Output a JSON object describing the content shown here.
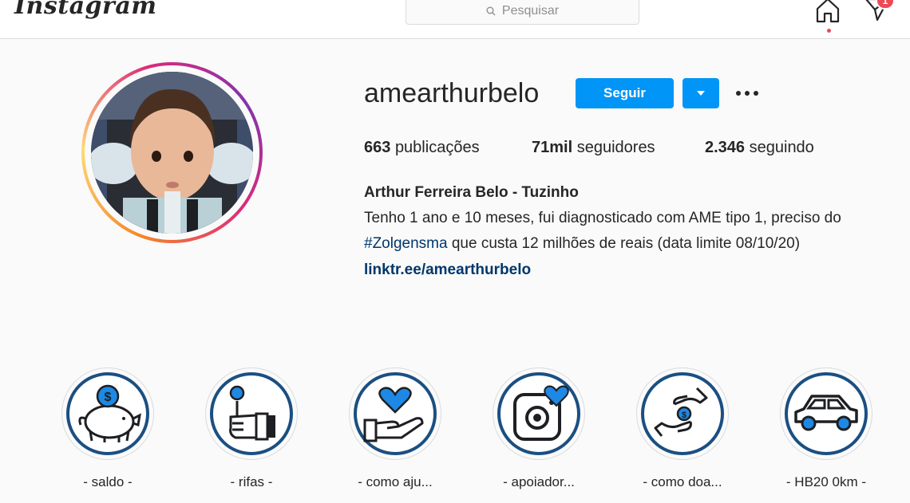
{
  "nav": {
    "logo": "Instagram",
    "search_placeholder": "Pesquisar",
    "notification_count": "1"
  },
  "profile": {
    "username": "amearthurbelo",
    "follow_label": "Seguir",
    "stats": {
      "posts_count": "663",
      "posts_label": "publicações",
      "followers_count": "71mil",
      "followers_label": "seguidores",
      "following_count": "2.346",
      "following_label": "seguindo"
    },
    "full_name": "Arthur Ferreira Belo - Tuzinho",
    "bio_line1": "Tenho 1 ano e 10 meses, fui diagnosticado com AME tipo 1, preciso do",
    "bio_hashtag": "#Zolgensma",
    "bio_line2_rest": " que custa 12 milhões de reais (data limite 08/10/20)",
    "link": "linktr.ee/amearthurbelo"
  },
  "highlights": [
    {
      "label": "- saldo -",
      "icon": "piggy-bank-icon"
    },
    {
      "label": "- rifas -",
      "icon": "hand-coin-icon"
    },
    {
      "label": "- como aju...",
      "icon": "hand-heart-icon"
    },
    {
      "label": "- apoiador...",
      "icon": "camera-heart-icon"
    },
    {
      "label": "- como doa...",
      "icon": "donate-hands-icon"
    },
    {
      "label": "- HB20 0km -",
      "icon": "car-icon"
    }
  ],
  "colors": {
    "accent": "#0095f6",
    "link": "#00376b",
    "highlight_ring": "#1b4f82",
    "badge": "#ed4956"
  }
}
